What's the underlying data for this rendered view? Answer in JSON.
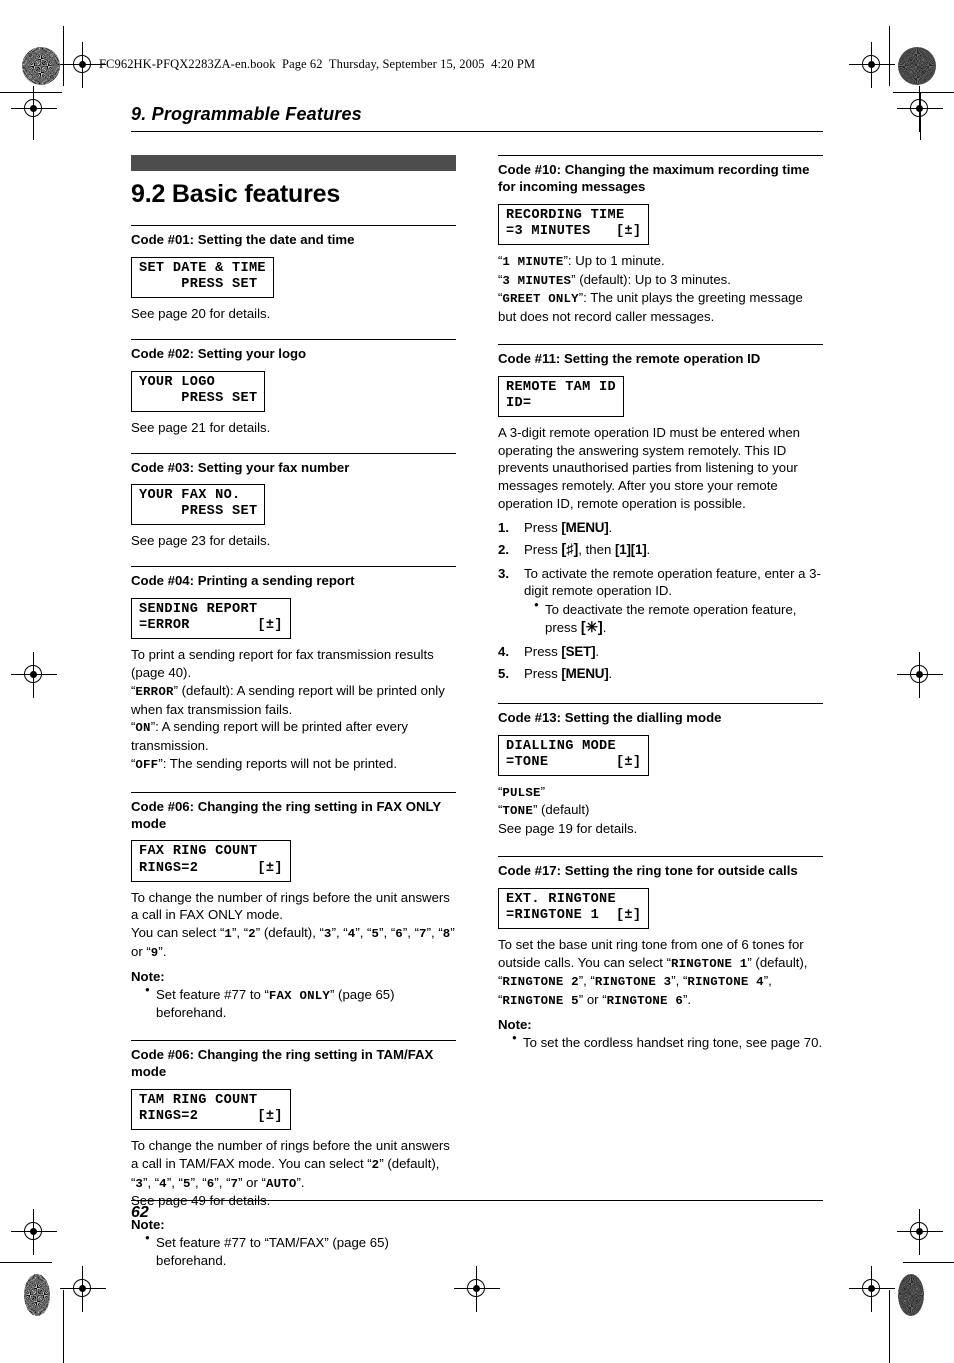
{
  "slug": "FC962HK-PFQX2283ZA-en.book  Page 62  Thursday, September 15, 2005  4:20 PM",
  "chapter": "9. Programmable Features",
  "section": {
    "number_title": "9.2 Basic features"
  },
  "page_number": "62",
  "colors": {
    "band": "#4d4d4d",
    "text": "#000000",
    "background": "#ffffff"
  },
  "left_column": [
    {
      "id": "code01",
      "heading": "Code #01: Setting the date and time",
      "lcd": [
        "SET DATE & TIME",
        "     PRESS SET"
      ],
      "paragraphs": [
        "See page 20 for details."
      ]
    },
    {
      "id": "code02",
      "heading": "Code #02: Setting your logo",
      "lcd": [
        "YOUR LOGO",
        "     PRESS SET"
      ],
      "paragraphs": [
        "See page 21 for details."
      ]
    },
    {
      "id": "code03",
      "heading": "Code #03: Setting your fax number",
      "lcd": [
        "YOUR FAX NO.",
        "     PRESS SET"
      ],
      "paragraphs": [
        "See page 23 for details."
      ]
    },
    {
      "id": "code04",
      "heading": "Code #04: Printing a sending report",
      "lcd": [
        "SENDING REPORT",
        "=ERROR        [±]"
      ],
      "paragraphs": [
        "To print a sending report for fax transmission results (page 40).",
        "“ERROR” (default): A sending report will be printed only when fax transmission fails.",
        "“ON”: A sending report will be printed after every transmission.",
        "“OFF”: The sending reports will not be printed."
      ],
      "para_mono": [
        {
          "para": 1,
          "terms": [
            "ERROR"
          ]
        },
        {
          "para": 2,
          "terms": [
            "ON"
          ]
        },
        {
          "para": 3,
          "terms": [
            "OFF"
          ]
        }
      ]
    },
    {
      "id": "code06-fax",
      "heading": "Code #06: Changing the ring setting in FAX ONLY mode",
      "lcd": [
        "FAX RING COUNT",
        "RINGS=2       [±]"
      ],
      "paragraphs": [
        "To change the number of rings before the unit answers a call in FAX ONLY mode.",
        "You can select “1”, “2” (default), “3”, “4”, “5”, “6”, “7”, “8” or “9”."
      ],
      "note_label": "Note:",
      "notes": [
        "Set feature #77 to “FAX ONLY” (page 65) beforehand."
      ]
    },
    {
      "id": "code06-tam",
      "heading": "Code #06: Changing the ring setting in TAM/FAX mode",
      "lcd": [
        "TAM RING COUNT",
        "RINGS=2       [±]"
      ],
      "paragraphs": [
        "To change the number of rings before the unit answers a call in TAM/FAX mode. You can select “2” (default), “3”, “4”, “5”, “6”, “7” or “AUTO”.",
        "See page 49 for details."
      ],
      "note_label": "Note:",
      "notes": [
        "Set feature #77 to “TAM/FAX” (page 65) beforehand."
      ]
    }
  ],
  "right_column": [
    {
      "id": "code10",
      "heading": "Code #10: Changing the maximum recording time for incoming messages",
      "lcd": [
        "RECORDING TIME",
        "=3 MINUTES   [±]"
      ],
      "paragraphs": [
        "“1 MINUTE”: Up to 1 minute.",
        "“3 MINUTES” (default): Up to 3 minutes.",
        "“GREET ONLY”: The unit plays the greeting message but does not record caller messages."
      ]
    },
    {
      "id": "code11",
      "heading": "Code #11: Setting the remote operation ID",
      "lcd": [
        "REMOTE TAM ID",
        "ID="
      ],
      "paragraphs": [
        "A 3-digit remote operation ID must be entered when operating the answering system remotely. This ID prevents unauthorised parties from listening to your messages remotely. After you store your remote operation ID, remote operation is possible."
      ],
      "steps": [
        {
          "text_before": "Press ",
          "key": "[MENU]",
          "text_after": "."
        },
        {
          "text_before": "Press ",
          "key": "[♯]",
          "text_mid": ", then ",
          "key2": "[1][1]",
          "text_after": "."
        },
        {
          "text_before": "To activate the remote operation feature, enter a 3-digit remote operation ID.",
          "substep": "To deactivate the remote operation feature, press ",
          "substep_key": "[✳]",
          "substep_after": "."
        },
        {
          "text_before": "Press ",
          "key": "[SET]",
          "text_after": "."
        },
        {
          "text_before": "Press ",
          "key": "[MENU]",
          "text_after": "."
        }
      ]
    },
    {
      "id": "code13",
      "heading": "Code #13: Setting the dialling mode",
      "lcd": [
        "DIALLING MODE",
        "=TONE        [±]"
      ],
      "paragraphs": [
        "“PULSE”",
        "“TONE” (default)",
        "See page 19 for details."
      ]
    },
    {
      "id": "code17",
      "heading": "Code #17: Setting the ring tone for outside calls",
      "lcd": [
        "EXT. RINGTONE",
        "=RINGTONE 1  [±]"
      ],
      "paragraphs": [
        "To set the base unit ring tone from one of 6 tones for outside calls. You can select “RINGTONE 1” (default), “RINGTONE 2”, “RINGTONE 3”, “RINGTONE 4”, “RINGTONE 5” or “RINGTONE 6”."
      ],
      "note_label": "Note:",
      "notes": [
        "To set the cordless handset ring tone, see page 70."
      ]
    }
  ]
}
